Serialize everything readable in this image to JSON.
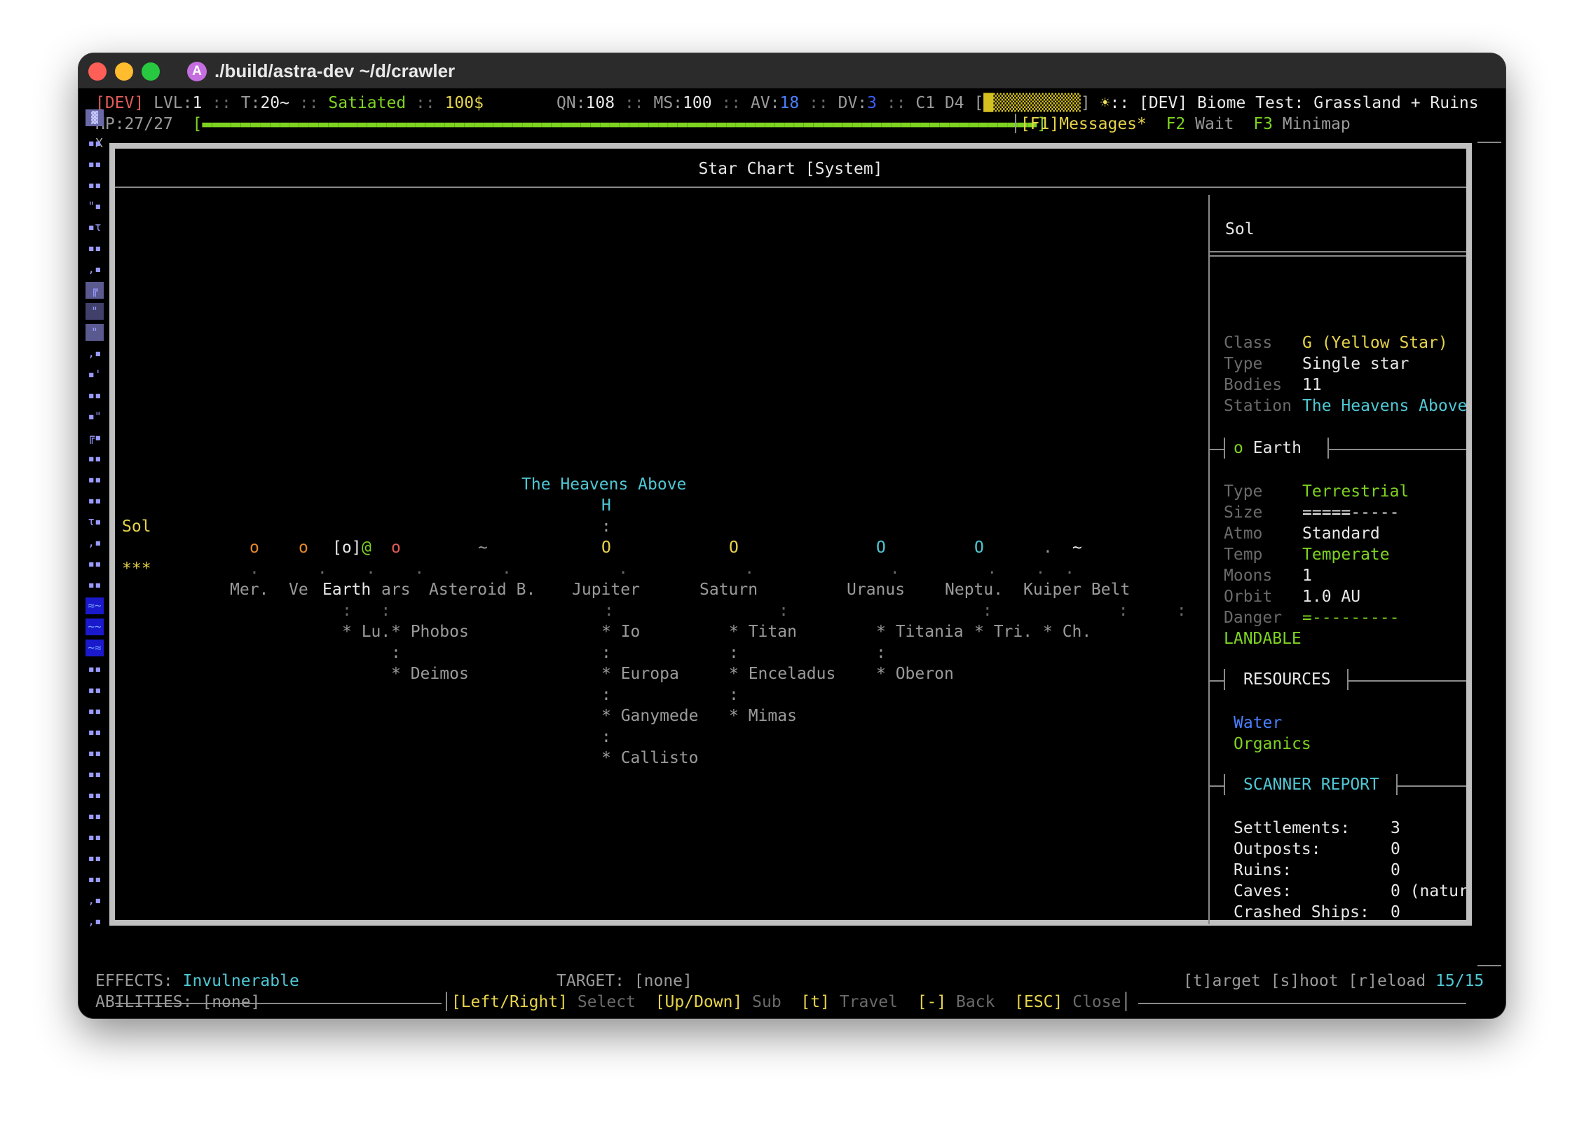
{
  "window": {
    "title": "./build/astra-dev ~/d/crawler",
    "app_icon_letter": "A"
  },
  "hud": {
    "dev": "[DEV]",
    "lvl_label": "LVL:",
    "lvl": "1",
    "sep": " :: ",
    "t_label": "T:",
    "t": "20~",
    "hunger": "Satiated",
    "money": "100$",
    "qn_label": "QN:",
    "qn": "108",
    "ms_label": "MS:",
    "ms": "100",
    "av_label": "AV:",
    "av": "18",
    "dv_label": "DV:",
    "dv": "3",
    "c_d": "C1 D4",
    "meter_open": "[",
    "meter_close": "]",
    "sun_icon": "☀",
    "location": ":: [DEV] Biome Test: Grassland + Ruins",
    "hp_label": "HP:",
    "hp": "27/27",
    "hp_bar": "[▬▬▬▬▬▬▬▬▬▬▬▬▬▬▬▬▬▬▬▬▬▬▬▬▬▬▬▬▬▬▬▬▬▬▬▬▬▬▬▬▬▬▬▬▬▬▬▬▬▬▬▬▬▬▬▬▬▬▬▬▬▬▬▬▬▬▬▬▬▬▬▬▬▬▬▬▬▬▬▬▬▬▬▬▬▬]",
    "hp_fraction": 1.0,
    "f1": "[F1]Messages*",
    "f2": "F2",
    "f2_label": "Wait",
    "f3": "F3",
    "f3_label": "Minimap",
    "x_mark": "X"
  },
  "starchart": {
    "title": "Star Chart [System]",
    "station_name": "The Heavens Above",
    "station_marker": "H",
    "star_label": "Sol",
    "star_glyph": "***",
    "planets": [
      {
        "glyph": "o",
        "name": "Mer."
      },
      {
        "glyph": "o",
        "name": "Ve"
      },
      {
        "glyph": "[o]",
        "name": "Earth",
        "selected": true
      },
      {
        "glyph": "o",
        "name": "ars"
      },
      {
        "glyph": "~",
        "name": "Asteroid B."
      },
      {
        "glyph": "O",
        "name": "Jupiter"
      },
      {
        "glyph": "O",
        "name": "Saturn"
      },
      {
        "glyph": "O",
        "name": "Uranus"
      },
      {
        "glyph": "O",
        "name": "Neptu."
      },
      {
        "glyph": ".",
        "name": ""
      },
      {
        "glyph": "~",
        "name": "Kuiper Belt"
      }
    ],
    "player_glyph": "@",
    "moons": {
      "earth": [
        "Lu."
      ],
      "mars": [
        "Phobos",
        "Deimos"
      ],
      "jupiter": [
        "Io",
        "Europa",
        "Ganymede",
        "Callisto"
      ],
      "saturn": [
        "Titan",
        "Enceladus",
        "Mimas"
      ],
      "uranus": [
        "Titania",
        "Oberon"
      ],
      "neptune": [
        "Tri."
      ],
      "pluto": [
        "Ch."
      ]
    },
    "footer": {
      "k1": "[Left/Right]",
      "l1": "Select",
      "k2": "[Up/Down]",
      "l2": "Sub",
      "k3": "[t]",
      "l3": "Travel",
      "k4": "[-]",
      "l4": "Back",
      "k5": "[ESC]",
      "l5": "Close"
    }
  },
  "info": {
    "system_name": "Sol",
    "star": [
      {
        "label": "Class",
        "value": "G (Yellow Star)"
      },
      {
        "label": "Type",
        "value": "Single star"
      },
      {
        "label": "Bodies",
        "value": "11"
      },
      {
        "label": "Station",
        "value": "The Heavens Above"
      }
    ],
    "planet_glyph": "o",
    "planet_name": "Earth",
    "planet": [
      {
        "label": "Type",
        "value": "Terrestrial"
      },
      {
        "label": "Size",
        "value": "=====-----"
      },
      {
        "label": "Atmo",
        "value": "Standard"
      },
      {
        "label": "Temp",
        "value": "Temperate"
      },
      {
        "label": "Moons",
        "value": "1"
      },
      {
        "label": "Orbit",
        "value": "1.0 AU"
      },
      {
        "label": "Danger",
        "value": "=---------"
      }
    ],
    "landable": "LANDABLE",
    "resources_title": "RESOURCES",
    "resources": [
      "Water",
      "Organics"
    ],
    "scanner_title": "SCANNER REPORT",
    "scanner": [
      {
        "label": "Settlements:",
        "value": "3"
      },
      {
        "label": "Outposts:",
        "value": "0"
      },
      {
        "label": "Ruins:",
        "value": "0"
      },
      {
        "label": "Caves:",
        "value": "0 (natur"
      },
      {
        "label": "Crashed Ships:",
        "value": "0"
      }
    ]
  },
  "bottom": {
    "effects_label": "EFFECTS:",
    "effects": "Invulnerable",
    "target_label": "TARGET:",
    "target": "[none]",
    "actions": "[t]arget [s]hoot [r]eload",
    "ammo": "15/15",
    "abilities_label": "ABILITIES:",
    "abilities": "[none]"
  },
  "colors": {
    "accent_cyan": "#4fc7d4",
    "green": "#7ed321",
    "yellow": "#e6d34a",
    "orange": "#e8892a",
    "red": "#e05a5a",
    "blue": "#4a7fff",
    "panel_border": "#c0c0c0"
  }
}
